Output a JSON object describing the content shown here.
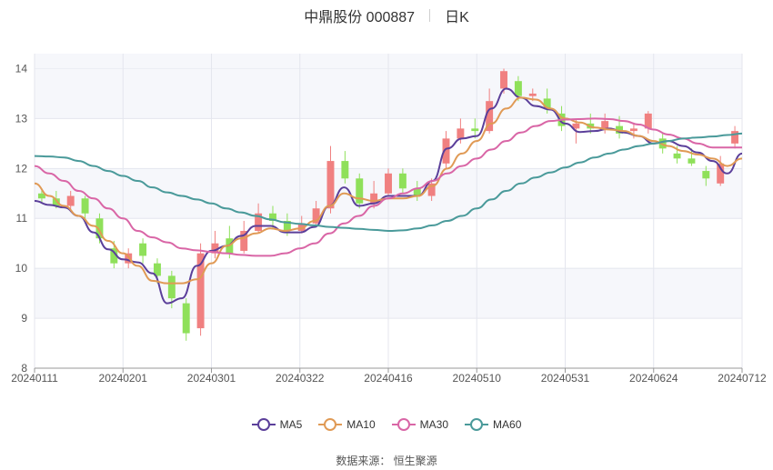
{
  "title": {
    "name": "中鼎股份 000887",
    "period": "日K"
  },
  "source": {
    "label": "数据来源：",
    "value": "恒生聚源"
  },
  "chart_data": {
    "type": "candlestick",
    "x_tick_labels": [
      "20240111",
      "20240201",
      "20240301",
      "20240322",
      "20240416",
      "20240510",
      "20240531",
      "20240624",
      "20240712"
    ],
    "y_ticks": [
      8,
      9,
      10,
      11,
      12,
      13,
      14
    ],
    "ylim": [
      8,
      14.3
    ],
    "grid": true,
    "legend_position": "bottom",
    "colors": {
      "up": "#f08080",
      "down": "#8fe05a",
      "MA5": "#5b3f9a",
      "MA10": "#e09a55",
      "MA30": "#d966a6",
      "MA60": "#4a9a9a"
    },
    "moving_averages": [
      {
        "name": "MA5",
        "values": [
          11.35,
          11.27,
          11.22,
          11.05,
          10.72,
          10.38,
          10.18,
          10.12,
          9.9,
          9.3,
          9.4,
          10.05,
          10.35,
          10.45,
          10.65,
          10.85,
          10.85,
          10.72,
          10.72,
          10.83,
          11.25,
          11.62,
          11.25,
          11.3,
          11.45,
          11.45,
          11.45,
          11.75,
          12.4,
          12.6,
          12.65,
          13.2,
          13.6,
          13.42,
          13.25,
          13.18,
          12.9,
          12.73,
          12.75,
          12.8,
          12.72,
          12.65,
          12.5,
          12.55,
          12.45,
          12.32,
          12.15,
          11.9,
          12.3
        ]
      },
      {
        "name": "MA10",
        "values": [
          11.7,
          11.45,
          11.25,
          11.05,
          10.85,
          10.55,
          10.3,
          10.05,
          9.75,
          9.7,
          9.7,
          9.78,
          10.1,
          10.45,
          10.6,
          10.7,
          10.8,
          10.75,
          10.8,
          10.95,
          11.25,
          11.5,
          11.4,
          11.35,
          11.4,
          11.4,
          11.45,
          11.65,
          12.0,
          12.3,
          12.55,
          12.9,
          13.2,
          13.42,
          13.38,
          13.2,
          13.0,
          12.92,
          12.82,
          12.78,
          12.75,
          12.65,
          12.55,
          12.45,
          12.35,
          12.28,
          12.2,
          12.05,
          12.2
        ]
      },
      {
        "name": "MA30",
        "values": [
          12.05,
          11.9,
          11.75,
          11.55,
          11.4,
          11.2,
          11.0,
          10.75,
          10.62,
          10.52,
          10.4,
          10.36,
          10.33,
          10.3,
          10.27,
          10.25,
          10.25,
          10.3,
          10.4,
          10.5,
          10.7,
          10.9,
          11.05,
          11.25,
          11.4,
          11.5,
          11.6,
          11.75,
          11.9,
          12.05,
          12.2,
          12.38,
          12.55,
          12.72,
          12.85,
          12.95,
          12.98,
          12.99,
          13.0,
          12.99,
          12.95,
          12.88,
          12.78,
          12.68,
          12.6,
          12.5,
          12.42,
          12.42,
          12.42
        ]
      },
      {
        "name": "MA60",
        "values": [
          12.25,
          12.24,
          12.22,
          12.15,
          12.05,
          11.95,
          11.85,
          11.75,
          11.62,
          11.52,
          11.45,
          11.38,
          11.3,
          11.2,
          11.12,
          11.05,
          10.98,
          10.92,
          10.89,
          10.86,
          10.83,
          10.81,
          10.79,
          10.77,
          10.75,
          10.76,
          10.8,
          10.86,
          10.95,
          11.05,
          11.2,
          11.38,
          11.55,
          11.7,
          11.82,
          11.92,
          12.02,
          12.12,
          12.22,
          12.3,
          12.38,
          12.45,
          12.5,
          12.55,
          12.6,
          12.62,
          12.64,
          12.67,
          12.7
        ]
      }
    ],
    "candles": [
      {
        "o": 11.5,
        "c": 11.4,
        "h": 11.6,
        "l": 11.3
      },
      {
        "o": 11.4,
        "c": 11.25,
        "h": 11.55,
        "l": 11.2
      },
      {
        "o": 11.25,
        "c": 11.45,
        "h": 11.55,
        "l": 11.15
      },
      {
        "o": 11.4,
        "c": 11.1,
        "h": 11.45,
        "l": 10.95
      },
      {
        "o": 11.0,
        "c": 10.6,
        "h": 11.1,
        "l": 10.5
      },
      {
        "o": 10.4,
        "c": 10.1,
        "h": 10.55,
        "l": 10.0
      },
      {
        "o": 10.1,
        "c": 10.3,
        "h": 10.4,
        "l": 10.0
      },
      {
        "o": 10.5,
        "c": 10.25,
        "h": 10.6,
        "l": 10.1
      },
      {
        "o": 10.1,
        "c": 9.85,
        "h": 10.2,
        "l": 9.7
      },
      {
        "o": 9.85,
        "c": 9.4,
        "h": 9.95,
        "l": 9.2
      },
      {
        "o": 9.3,
        "c": 8.7,
        "h": 9.4,
        "l": 8.55
      },
      {
        "o": 8.8,
        "c": 10.3,
        "h": 10.5,
        "l": 8.65
      },
      {
        "o": 10.3,
        "c": 10.5,
        "h": 10.75,
        "l": 10.2
      },
      {
        "o": 10.6,
        "c": 10.3,
        "h": 10.85,
        "l": 10.2
      },
      {
        "o": 10.35,
        "c": 10.75,
        "h": 10.95,
        "l": 10.3
      },
      {
        "o": 10.75,
        "c": 11.1,
        "h": 11.3,
        "l": 10.7
      },
      {
        "o": 11.1,
        "c": 10.95,
        "h": 11.25,
        "l": 10.8
      },
      {
        "o": 10.95,
        "c": 10.75,
        "h": 11.1,
        "l": 10.65
      },
      {
        "o": 10.75,
        "c": 10.9,
        "h": 11.05,
        "l": 10.7
      },
      {
        "o": 10.9,
        "c": 11.2,
        "h": 11.35,
        "l": 10.85
      },
      {
        "o": 11.2,
        "c": 12.15,
        "h": 12.45,
        "l": 11.1
      },
      {
        "o": 12.15,
        "c": 11.8,
        "h": 12.35,
        "l": 11.7
      },
      {
        "o": 11.8,
        "c": 11.3,
        "h": 11.9,
        "l": 11.2
      },
      {
        "o": 11.3,
        "c": 11.5,
        "h": 11.75,
        "l": 11.2
      },
      {
        "o": 11.5,
        "c": 11.9,
        "h": 12.0,
        "l": 11.45
      },
      {
        "o": 11.9,
        "c": 11.6,
        "h": 12.0,
        "l": 11.5
      },
      {
        "o": 11.6,
        "c": 11.45,
        "h": 11.75,
        "l": 11.35
      },
      {
        "o": 11.45,
        "c": 11.7,
        "h": 11.8,
        "l": 11.35
      },
      {
        "o": 12.1,
        "c": 12.6,
        "h": 12.75,
        "l": 12.0
      },
      {
        "o": 12.6,
        "c": 12.8,
        "h": 13.0,
        "l": 12.5
      },
      {
        "o": 12.8,
        "c": 12.75,
        "h": 13.0,
        "l": 12.6
      },
      {
        "o": 12.75,
        "c": 13.35,
        "h": 13.6,
        "l": 12.7
      },
      {
        "o": 13.6,
        "c": 13.95,
        "h": 14.0,
        "l": 13.5
      },
      {
        "o": 13.75,
        "c": 13.45,
        "h": 13.85,
        "l": 13.35
      },
      {
        "o": 13.45,
        "c": 13.5,
        "h": 13.6,
        "l": 13.35
      },
      {
        "o": 13.4,
        "c": 13.2,
        "h": 13.6,
        "l": 13.1
      },
      {
        "o": 13.1,
        "c": 12.85,
        "h": 13.25,
        "l": 12.75
      },
      {
        "o": 12.8,
        "c": 12.9,
        "h": 13.0,
        "l": 12.5
      },
      {
        "o": 12.9,
        "c": 12.8,
        "h": 13.1,
        "l": 12.7
      },
      {
        "o": 12.8,
        "c": 12.95,
        "h": 13.1,
        "l": 12.7
      },
      {
        "o": 12.85,
        "c": 12.7,
        "h": 13.05,
        "l": 12.6
      },
      {
        "o": 12.75,
        "c": 12.8,
        "h": 12.9,
        "l": 12.6
      },
      {
        "o": 12.8,
        "c": 13.1,
        "h": 13.15,
        "l": 12.7
      },
      {
        "o": 12.6,
        "c": 12.4,
        "h": 12.7,
        "l": 12.3
      },
      {
        "o": 12.3,
        "c": 12.2,
        "h": 12.45,
        "l": 12.1
      },
      {
        "o": 12.2,
        "c": 12.1,
        "h": 12.4,
        "l": 12.05
      },
      {
        "o": 11.95,
        "c": 11.8,
        "h": 12.05,
        "l": 11.65
      },
      {
        "o": 11.7,
        "c": 12.1,
        "h": 12.25,
        "l": 11.65
      },
      {
        "o": 12.5,
        "c": 12.75,
        "h": 12.85,
        "l": 12.4
      }
    ]
  },
  "legend": [
    {
      "label": "MA5",
      "color": "#5b3f9a"
    },
    {
      "label": "MA10",
      "color": "#e09a55"
    },
    {
      "label": "MA30",
      "color": "#d966a6"
    },
    {
      "label": "MA60",
      "color": "#4a9a9a"
    }
  ]
}
